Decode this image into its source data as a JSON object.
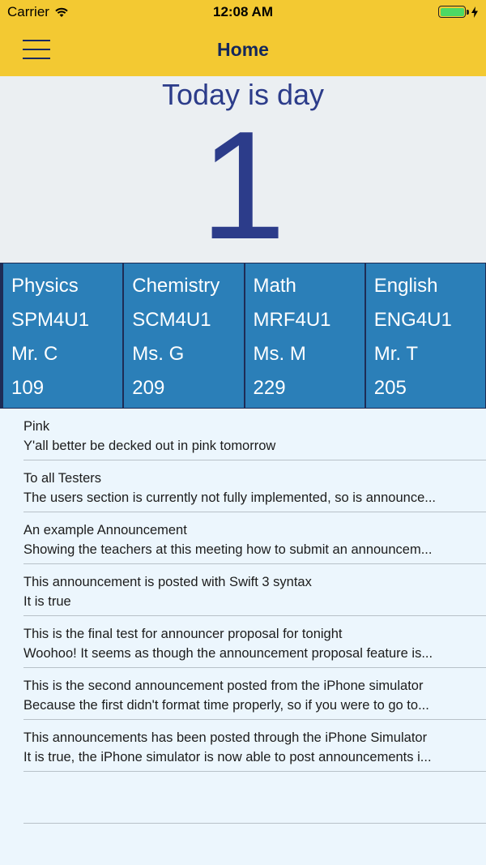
{
  "status_bar": {
    "carrier": "Carrier",
    "time": "12:08 AM",
    "icons": [
      "wifi-icon",
      "battery-icon",
      "charging-bolt-icon"
    ]
  },
  "nav": {
    "title": "Home",
    "menu_icon": "hamburger-menu-icon"
  },
  "day": {
    "label": "Today is day",
    "number": "1"
  },
  "schedule": [
    {
      "subject": "Physics",
      "code": "SPM4U1",
      "teacher": "Mr. C",
      "room": "109"
    },
    {
      "subject": "Chemistry",
      "code": "SCM4U1",
      "teacher": "Ms. G",
      "room": "209"
    },
    {
      "subject": "Math",
      "code": "MRF4U1",
      "teacher": "Ms. M",
      "room": "229"
    },
    {
      "subject": "English",
      "code": "ENG4U1",
      "teacher": "Mr. T",
      "room": "205"
    }
  ],
  "announcements": [
    {
      "title": "Pink",
      "body": "Y'all better be decked out in pink tomorrow"
    },
    {
      "title": "To all Testers",
      "body": "The users section is currently not fully implemented, so is announce..."
    },
    {
      "title": "An example Announcement",
      "body": "Showing the teachers at this meeting how to submit an announcem..."
    },
    {
      "title": "This announcement is posted with Swift 3 syntax",
      "body": "It is true"
    },
    {
      "title": "This is the final test for announcer proposal for tonight",
      "body": "Woohoo! It seems as though the announcement proposal feature is..."
    },
    {
      "title": "This is the second announcement posted from the iPhone simulator",
      "body": "Because the first didn't format time properly, so if you were to go to..."
    },
    {
      "title": "This announcements has been posted through the iPhone Simulator",
      "body": "It is true, the iPhone simulator is now able to post announcements i..."
    }
  ],
  "colors": {
    "nav_background": "#f3c932",
    "accent_text": "#2c3c8a",
    "course_tile": "#2b7fb8"
  }
}
